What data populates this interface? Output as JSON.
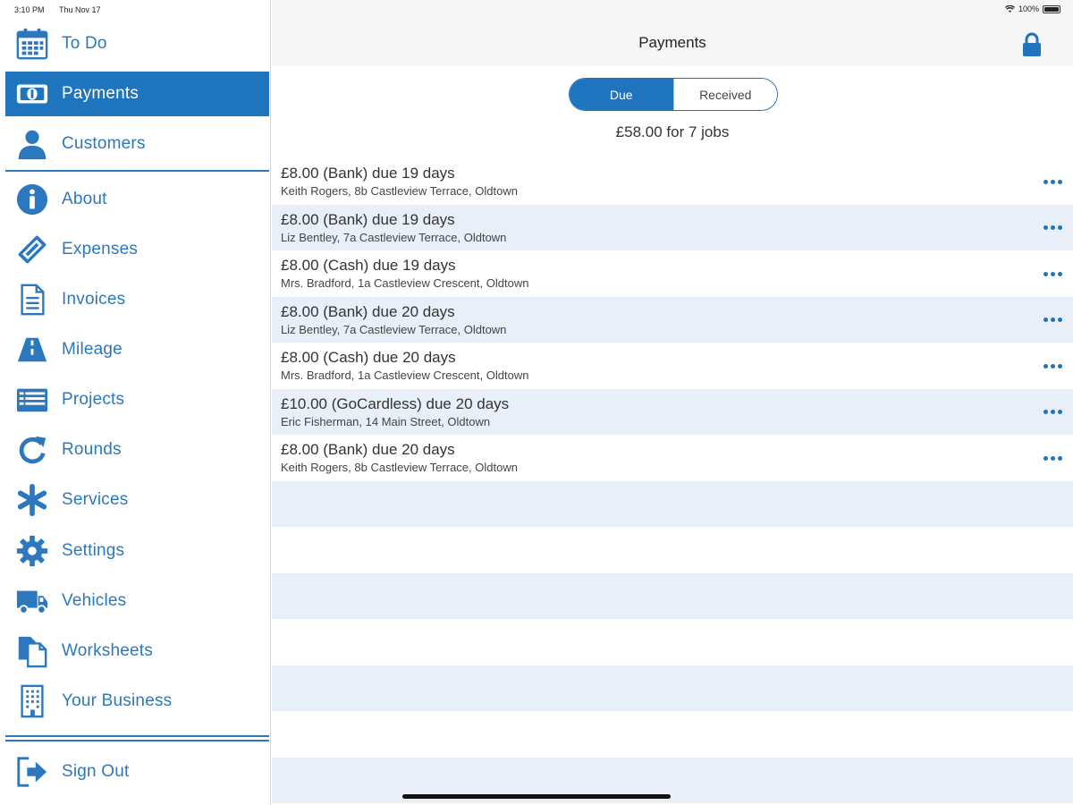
{
  "status": {
    "time": "3:10 PM",
    "date": "Thu Nov 17",
    "battery": "100%"
  },
  "sidebar": {
    "items": [
      {
        "label": "To Do",
        "icon": "calendar-icon"
      },
      {
        "label": "Payments",
        "icon": "money-icon",
        "active": true
      },
      {
        "label": "Customers",
        "icon": "person-icon"
      },
      {
        "label": "About",
        "icon": "info-icon"
      },
      {
        "label": "Expenses",
        "icon": "ticket-icon"
      },
      {
        "label": "Invoices",
        "icon": "document-icon"
      },
      {
        "label": "Mileage",
        "icon": "road-icon"
      },
      {
        "label": "Projects",
        "icon": "list-icon"
      },
      {
        "label": "Rounds",
        "icon": "refresh-icon"
      },
      {
        "label": "Services",
        "icon": "asterisk-icon"
      },
      {
        "label": "Settings",
        "icon": "gear-icon"
      },
      {
        "label": "Vehicles",
        "icon": "truck-icon"
      },
      {
        "label": "Worksheets",
        "icon": "copy-icon"
      },
      {
        "label": "Your Business",
        "icon": "building-icon"
      }
    ],
    "signout": {
      "label": "Sign Out",
      "icon": "sign-out-icon"
    }
  },
  "header": {
    "title": "Payments",
    "lock_icon": "lock-icon"
  },
  "segmented": {
    "due": "Due",
    "received": "Received",
    "selected": "Due"
  },
  "summary": "£58.00 for 7 jobs",
  "payments": [
    {
      "title": "£8.00 (Bank) due 19 days",
      "subtitle": "Keith Rogers, 8b Castleview Terrace, Oldtown"
    },
    {
      "title": "£8.00 (Bank) due 19 days",
      "subtitle": "Liz Bentley, 7a Castleview Terrace, Oldtown"
    },
    {
      "title": "£8.00 (Cash) due 19 days",
      "subtitle": "Mrs. Bradford, 1a Castleview Crescent, Oldtown"
    },
    {
      "title": "£8.00 (Bank) due 20 days",
      "subtitle": "Liz Bentley, 7a Castleview Terrace, Oldtown"
    },
    {
      "title": "£8.00 (Cash) due 20 days",
      "subtitle": "Mrs. Bradford, 1a Castleview Crescent, Oldtown"
    },
    {
      "title": "£10.00 (GoCardless) due 20 days",
      "subtitle": "Eric Fisherman, 14 Main Street, Oldtown"
    },
    {
      "title": "£8.00 (Bank) due 20 days",
      "subtitle": "Keith Rogers, 8b Castleview Terrace, Oldtown"
    }
  ],
  "colors": {
    "accent": "#1e74bd",
    "row_alt": "#e8eff8",
    "header_bg": "#f6f6f6"
  }
}
